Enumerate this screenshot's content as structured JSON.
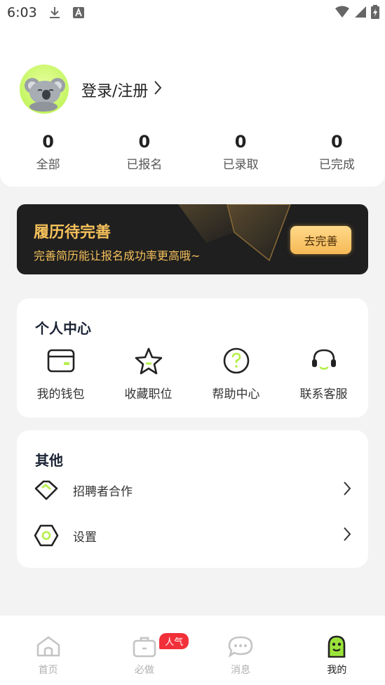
{
  "status_bar": {
    "time": "6:03"
  },
  "profile": {
    "login_label": "登录/注册"
  },
  "stats": [
    {
      "count": "0",
      "label": "全部"
    },
    {
      "count": "0",
      "label": "已报名"
    },
    {
      "count": "0",
      "label": "已录取"
    },
    {
      "count": "0",
      "label": "已完成"
    }
  ],
  "resume_banner": {
    "title": "履历待完善",
    "subtitle": "完善简历能让报名成功率更高哦~",
    "button_label": "去完善"
  },
  "personal_center": {
    "title": "个人中心",
    "items": [
      {
        "label": "我的钱包",
        "icon": "wallet-icon"
      },
      {
        "label": "收藏职位",
        "icon": "star-icon"
      },
      {
        "label": "帮助中心",
        "icon": "help-icon"
      },
      {
        "label": "联系客服",
        "icon": "headset-icon"
      }
    ]
  },
  "other": {
    "title": "其他",
    "items": [
      {
        "label": "招聘者合作",
        "icon": "handshake-icon"
      },
      {
        "label": "设置",
        "icon": "settings-icon"
      }
    ]
  },
  "tab_bar": {
    "tabs": [
      {
        "label": "首页",
        "icon": "home-icon"
      },
      {
        "label": "必做",
        "icon": "briefcase-icon"
      },
      {
        "label": "消息",
        "icon": "message-icon"
      },
      {
        "label": "我的",
        "icon": "mine-icon"
      }
    ],
    "badge": "人气",
    "active_tab": "我的"
  },
  "colors": {
    "accent": "#b5f04a",
    "banner_gold": "#f5c15b",
    "badge_red": "#f2303a"
  }
}
